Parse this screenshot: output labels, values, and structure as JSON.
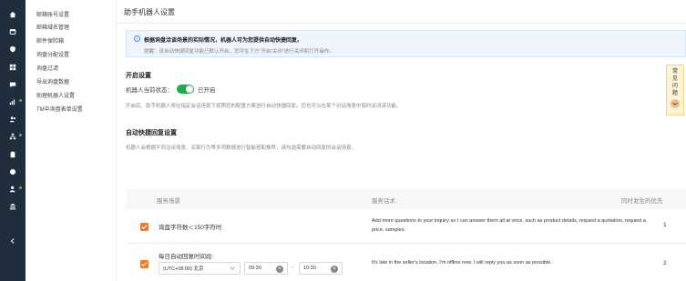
{
  "rail": {
    "icons": [
      "home-icon",
      "mailbox-icon",
      "shield-icon",
      "grid-icon",
      "message-icon",
      "analytics-icon",
      "contacts-icon",
      "sitemap-icon",
      "files-icon",
      "globe-icon",
      "user-settings-icon",
      "bank-icon",
      "collapse-icon"
    ]
  },
  "sidebar": {
    "items": [
      {
        "label": "邮箱账号设置"
      },
      {
        "label": "邮箱域名管理"
      },
      {
        "label": "邮件保险箱"
      },
      {
        "label": "询盘分配设置"
      },
      {
        "label": "询盘过滤"
      },
      {
        "label": "导出询盘数据"
      },
      {
        "label": "助理机器人设置"
      },
      {
        "label": "TM中询盘表单设置"
      }
    ]
  },
  "page": {
    "title": "助手机器人设置"
  },
  "notice": {
    "title": "根据询盘洽谈场景的实际情况，机器人可为您提供自动快捷回复。",
    "hint": "提醒：该自动快捷回复功能已默认开启，您可在下方“开启/关闭”进行关闭和打开操作。"
  },
  "enable": {
    "title": "开启设置",
    "status_label": "机器人当前状态：",
    "status_value": "已开启",
    "desc": "开启后，助手机器人将在指定会话场景下按照您的配置方案进行自动快捷回复。您也可以在某个对话场景中临时关闭该功能。"
  },
  "auto_reply": {
    "title": "自动快捷回复设置",
    "desc": "机器人会根据不同洽谈场景、买家行为等多项数据进行智能搭配推荐，请勾选需要自动回复的会话场景。"
  },
  "faq": {
    "label_chars": [
      "常",
      "见",
      "问",
      "题"
    ]
  },
  "table": {
    "headers": {
      "scenario": "服务场景",
      "script": "服务话术",
      "priority": "同时发生的优先"
    },
    "rows": [
      {
        "checked": true,
        "scenario": "询盘字符数＜150字符时",
        "script": "Add more questions to your inquiry so I can answer them all at once, such as product details, request a quotation, request a price, samples.",
        "priority": "1"
      },
      {
        "checked": true,
        "scenario": "每日自动回复时间段:",
        "timezone": "(UTC+08:00) 北京",
        "start_time": "09:30",
        "separator": "-",
        "end_time": "10:30",
        "script": "It's late in the seller's location, I'm offline now. I will reply you as soon as possible.",
        "priority": "2"
      }
    ]
  },
  "colors": {
    "rail": "#1f2d3d",
    "toggle_on": "#1cae48",
    "checkbox": "#f0782a",
    "notice_bg": "#eef5ff"
  }
}
